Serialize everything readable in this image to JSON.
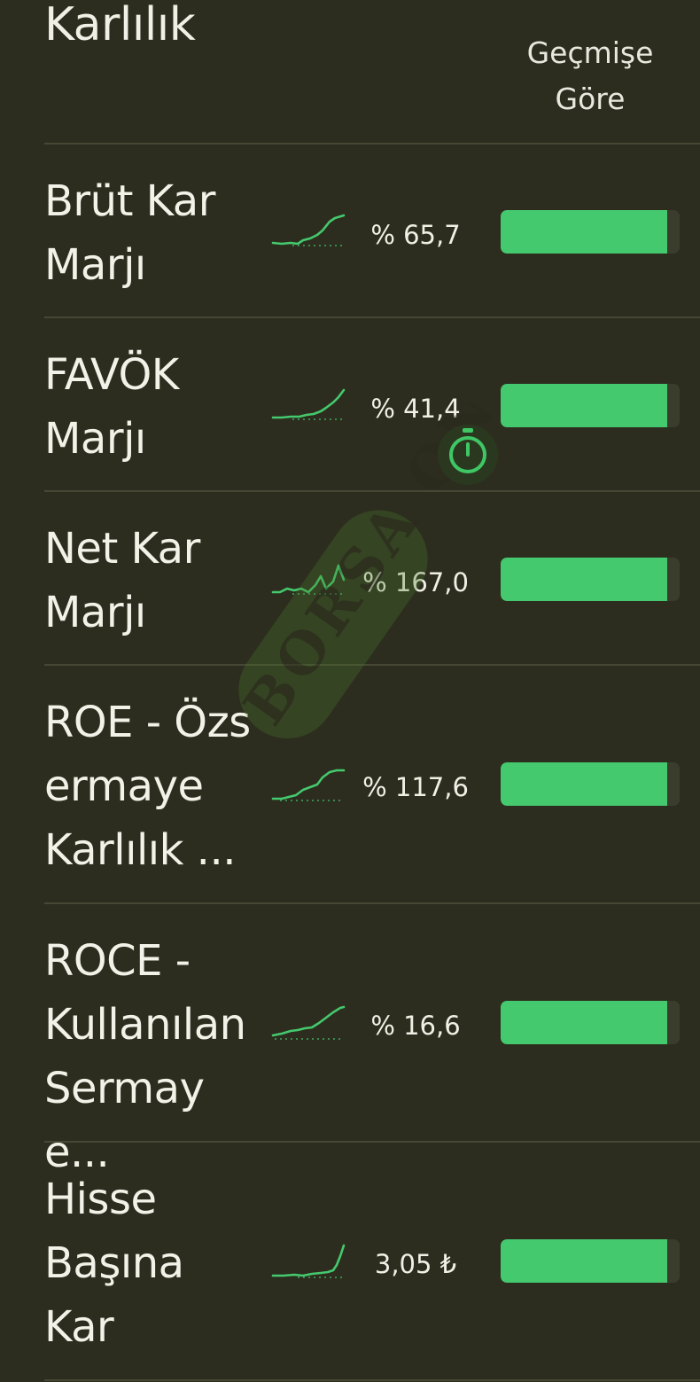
{
  "header": {
    "title": "Karlılık",
    "column_header": "Geçmişe\nGöre"
  },
  "watermark": {
    "text": "BORSA ON"
  },
  "colors": {
    "background": "#2c2d1e",
    "accent_green": "#45c96e",
    "divider": "#474834"
  },
  "rows": [
    {
      "label": "Brüt Kar\nMarjı",
      "value": "% 65,7",
      "score_fraction": 0.93,
      "trend": "rising"
    },
    {
      "label": "FAVÖK\nMarjı",
      "value": "% 41,4",
      "score_fraction": 0.93,
      "trend": "rising"
    },
    {
      "label": "Net Kar\nMarjı",
      "value": "% 167,0",
      "score_fraction": 0.93,
      "trend": "spiky"
    },
    {
      "label": "ROE - Özs\nermaye\nKarlılık ...",
      "value": "% 117,6",
      "score_fraction": 0.93,
      "trend": "rising"
    },
    {
      "label": "ROCE -\nKullanılan\nSermaye...",
      "value": "% 16,6",
      "score_fraction": 0.93,
      "trend": "rising"
    },
    {
      "label": "Hisse\nBaşına\nKar",
      "value": "3,05 ₺",
      "score_fraction": 0.93,
      "trend": "late-rise"
    }
  ]
}
